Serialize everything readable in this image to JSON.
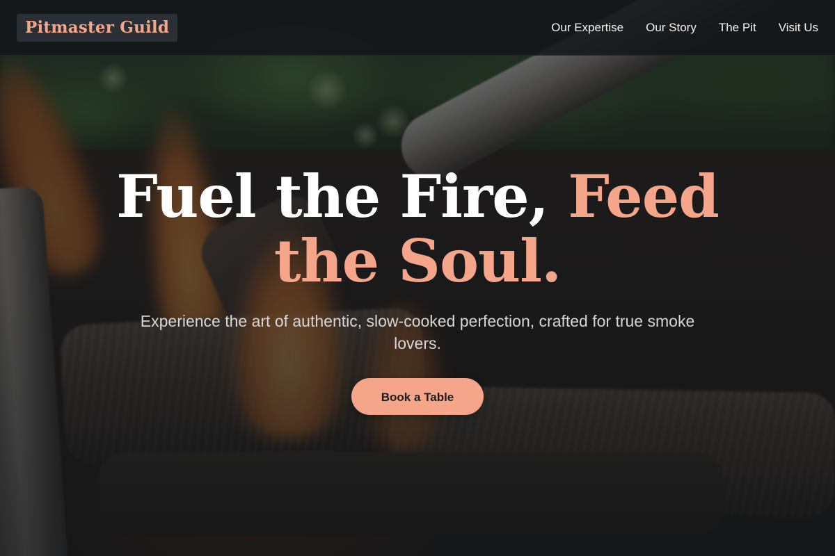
{
  "brand": {
    "name": "Pitmaster Guild"
  },
  "nav": {
    "items": [
      {
        "label": "Our Expertise"
      },
      {
        "label": "Our Story"
      },
      {
        "label": "The Pit"
      },
      {
        "label": "Visit Us"
      }
    ]
  },
  "hero": {
    "title_plain": "Fuel the Fire,",
    "title_accent": "Feed the Soul.",
    "subtitle": "Experience the art of authentic, slow-cooked perfection, crafted for true smoke lovers.",
    "cta_label": "Book a Table",
    "background_image": "bbq-grill-fire-with-tongs"
  },
  "colors": {
    "accent": "#f4a58a",
    "nav_background": "#141618",
    "logo_background": "#2a2f35",
    "text_primary": "#ffffff",
    "text_secondary": "#d7d7d7"
  }
}
